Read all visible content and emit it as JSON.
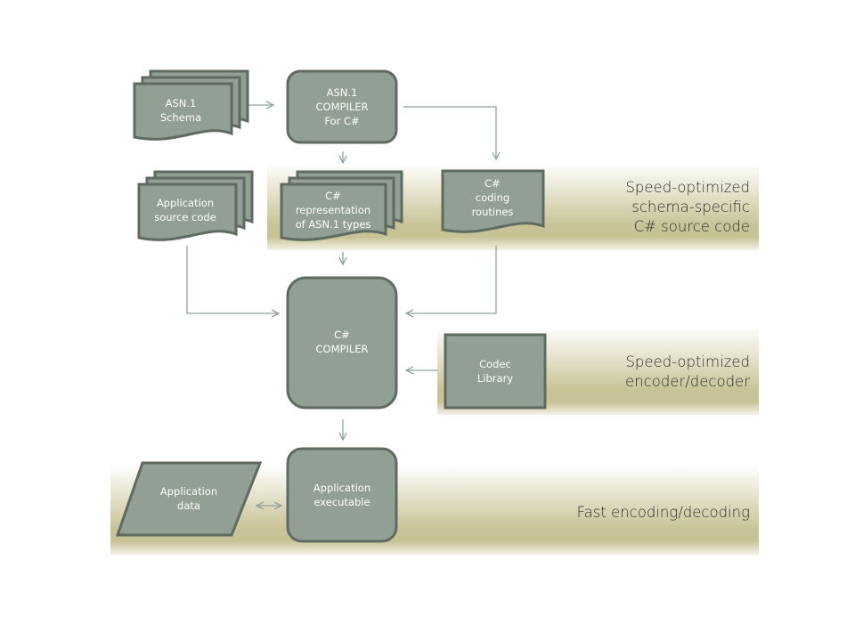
{
  "colors": {
    "shape_fill": "#919f94",
    "shape_stroke": "#5f6a61",
    "band": "#c8c396",
    "arrow": "#8fa39a"
  },
  "nodes": {
    "asn_schema": [
      "ASN.1",
      "Schema"
    ],
    "asn_compiler": [
      "ASN.1",
      "COMPILER",
      "For C#"
    ],
    "app_source": [
      "Application",
      "source code"
    ],
    "cs_representation": [
      "C#",
      "representation",
      "of ASN.1 types"
    ],
    "cs_coding_routines": [
      "C#",
      "coding",
      "routines"
    ],
    "cs_compiler": [
      "C#",
      "COMPILER"
    ],
    "codec_library": [
      "Codec",
      "Library"
    ],
    "app_data": [
      "Application",
      "data"
    ],
    "app_executable": [
      "Application",
      "executable"
    ]
  },
  "bands": {
    "source_code": [
      "Speed-optimized",
      "schema-specific",
      "C# source code"
    ],
    "encoder_decoder": [
      "Speed-optimized",
      "encoder/decoder"
    ],
    "fast": [
      "Fast encoding/decoding"
    ]
  }
}
